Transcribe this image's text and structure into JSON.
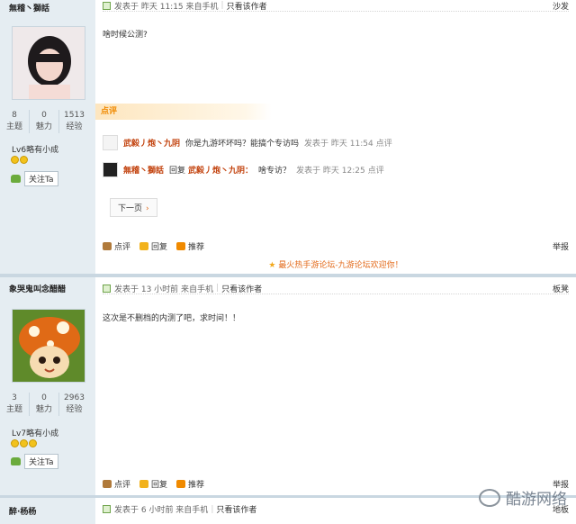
{
  "post1": {
    "author": "無稽丶獅話",
    "stats": [
      {
        "value": "8",
        "label": "主题"
      },
      {
        "value": "0",
        "label": "魅力"
      },
      {
        "value": "1513",
        "label": "经验"
      }
    ],
    "level": "Lv6略有小成",
    "follow": "关注Ta",
    "header": {
      "posted": "发表于 昨天 11:15 来自手机",
      "only_author": "只看该作者",
      "floor": "沙发"
    },
    "body": "啥时候公测?",
    "dianping_label": "点评",
    "comments": [
      {
        "name": "武毅丿炮丶九阴",
        "reply": "",
        "name2": "",
        "text": "你是九游坏坏吗？能搞个专访吗",
        "time": "发表于 昨天 11:54",
        "action": "点评"
      },
      {
        "name": "無稽丶獅話",
        "reply": "回复",
        "name2": "武毅丿炮丶九阴：",
        "text": "啥专访？",
        "time": "发表于 昨天 12:25",
        "action": "点评"
      }
    ],
    "next_page": "下一页",
    "actions": {
      "dianping": "点评",
      "reply": "回复",
      "recommend": "推荐",
      "report": "举报"
    },
    "promo": "最火热手游论坛-九游论坛欢迎你！"
  },
  "post2": {
    "author": "象哭鬼叫念醋醋",
    "stats": [
      {
        "value": "3",
        "label": "主题"
      },
      {
        "value": "0",
        "label": "魅力"
      },
      {
        "value": "2963",
        "label": "经验"
      }
    ],
    "level": "Lv7略有小成",
    "follow": "关注Ta",
    "header": {
      "posted": "发表于 13 小时前 来自手机",
      "only_author": "只看该作者",
      "floor": "板凳"
    },
    "body": "这次是不删档的内测了吧，求时间！！",
    "actions": {
      "dianping": "点评",
      "reply": "回复",
      "recommend": "推荐",
      "report": "举报"
    }
  },
  "post3": {
    "author": "醉·杨杨",
    "header": {
      "posted": "发表于 6 小时前 来自手机",
      "only_author": "只看该作者",
      "floor": "地板"
    }
  },
  "watermark": "酷游网络",
  "colors": {
    "sidebar": "#e5edf2",
    "accent": "#e36b1c",
    "name": "#c2410c"
  }
}
